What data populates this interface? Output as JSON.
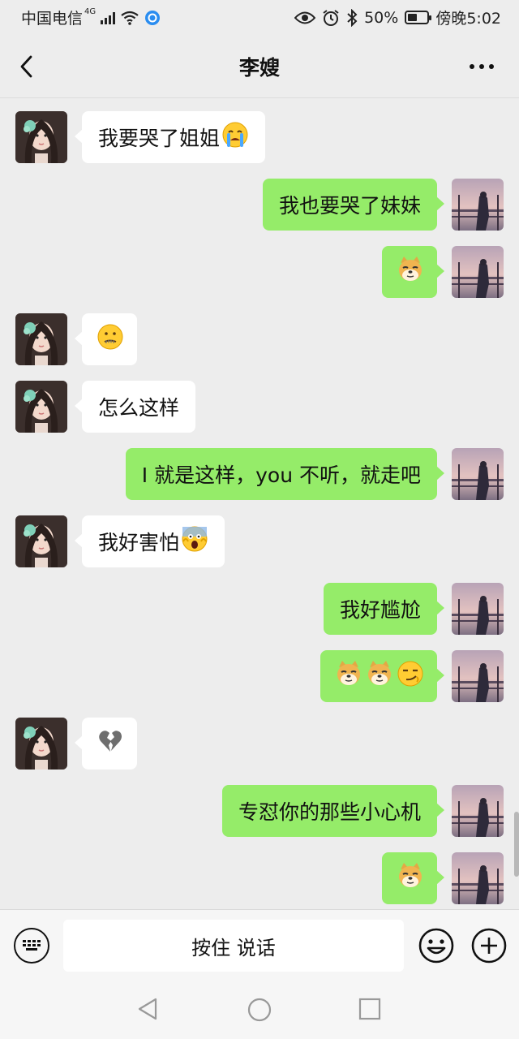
{
  "status_bar": {
    "carrier": "中国电信",
    "network": "4G",
    "battery": "50%",
    "battery_level": 0.5,
    "time": "傍晚5:02"
  },
  "header": {
    "title": "李嫂"
  },
  "messages": [
    {
      "side": "in",
      "text": "我要哭了姐姐",
      "emoji": [
        "loudly-crying-face-icon"
      ]
    },
    {
      "side": "out",
      "text": "我也要哭了妹妹",
      "emoji": []
    },
    {
      "side": "out",
      "text": "",
      "emoji": [
        "doge-icon"
      ]
    },
    {
      "side": "in",
      "text": "",
      "emoji": [
        "zipper-mouth-icon"
      ]
    },
    {
      "side": "in",
      "text": "怎么这样",
      "emoji": []
    },
    {
      "side": "out",
      "text": "I 就是这样，you 不听，就走吧",
      "emoji": []
    },
    {
      "side": "in",
      "text": "我好害怕",
      "emoji": [
        "screaming-face-icon"
      ]
    },
    {
      "side": "out",
      "text": "我好尴尬",
      "emoji": []
    },
    {
      "side": "out",
      "text": "",
      "emoji": [
        "doge-icon",
        "doge-icon",
        "smirk-face-icon"
      ]
    },
    {
      "side": "in",
      "text": "",
      "emoji": [
        "broken-heart-icon"
      ]
    },
    {
      "side": "out",
      "text": "专怼你的那些小心机",
      "emoji": []
    },
    {
      "side": "out",
      "text": "",
      "emoji": [
        "doge-icon"
      ]
    }
  ],
  "input_bar": {
    "hold_to_talk": "按住 说话"
  },
  "colors": {
    "background": "#ededed",
    "outgoing_bubble": "#95ec69",
    "incoming_bubble": "#ffffff"
  }
}
